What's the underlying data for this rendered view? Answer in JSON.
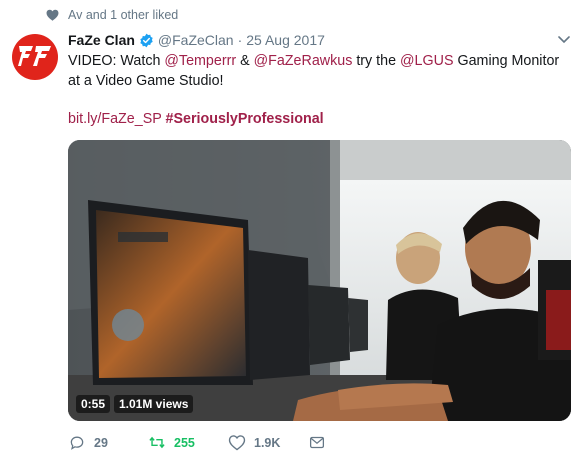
{
  "social_context": {
    "text": "Av and 1 other liked"
  },
  "author": {
    "name": "FaZe Clan",
    "handle": "@FaZeClan",
    "separator": "·",
    "date": "25 Aug 2017"
  },
  "tweet": {
    "line1_prefix": "VIDEO: Watch ",
    "mention1": "@Temperrr",
    "line1_mid": " & ",
    "mention2": "@FaZeRawkus",
    "line1_mid2": " try the ",
    "mention3": "@LGUS",
    "line1_suffix": " Gaming Monitor at a Video Game Studio!",
    "link": "bit.ly/FaZe_SP",
    "hashtag": "#SeriouslyProfessional"
  },
  "media": {
    "duration": "0:55",
    "views": "1.01M views"
  },
  "actions": {
    "reply_count": "29",
    "retweet_count": "255",
    "like_count": "1.9K"
  },
  "colors": {
    "link": "#a0214a",
    "retweet_active": "#17bf63",
    "muted": "#657786",
    "avatar_bg": "#e0241b",
    "verified": "#1da1f2"
  },
  "icons": {
    "social": "heart-icon",
    "verified": "verified-badge-icon",
    "caret": "chevron-down-icon",
    "reply": "reply-icon",
    "retweet": "retweet-icon",
    "like": "like-icon",
    "dm": "message-icon"
  }
}
